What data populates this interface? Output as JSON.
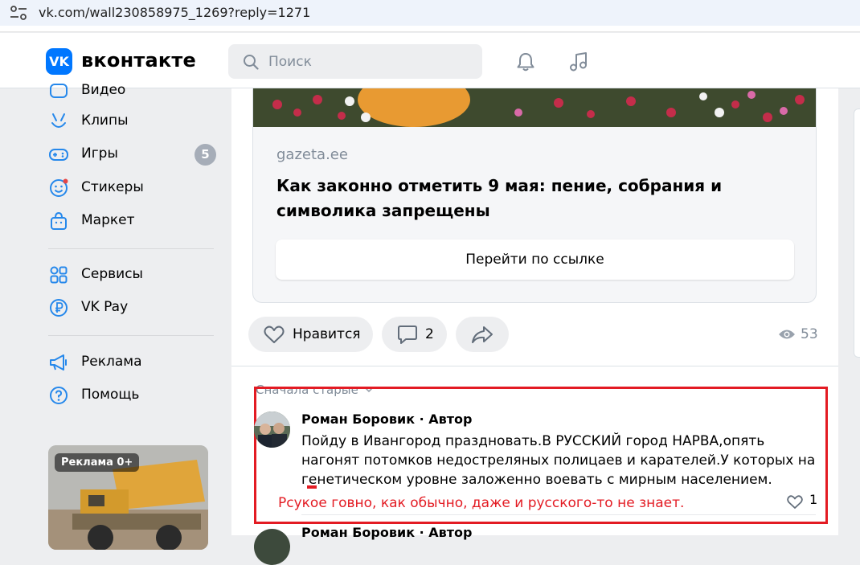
{
  "browser": {
    "url": "vk.com/wall230858975_1269?reply=1271"
  },
  "header": {
    "logo_mark": "VK",
    "logo_text": "вконтакте",
    "search_placeholder": "Поиск"
  },
  "sidebar": {
    "items": [
      {
        "label": "Видео",
        "icon": "video-icon"
      },
      {
        "label": "Клипы",
        "icon": "clips-icon"
      },
      {
        "label": "Игры",
        "icon": "gamepad-icon",
        "badge": "5"
      },
      {
        "label": "Стикеры",
        "icon": "sticker-icon"
      },
      {
        "label": "Маркет",
        "icon": "market-bag-icon"
      },
      {
        "label": "Сервисы",
        "icon": "services-grid-icon"
      },
      {
        "label": "VK Pay",
        "icon": "ruble-icon"
      },
      {
        "label": "Реклама",
        "icon": "megaphone-icon"
      },
      {
        "label": "Помощь",
        "icon": "help-icon"
      }
    ],
    "ad_label": "Реклама 0+"
  },
  "post": {
    "link": {
      "domain": "gazeta.ee",
      "title": "Как законно отметить 9 мая: пение, собрания и символика запрещены",
      "button": "Перейти по ссылке"
    },
    "actions": {
      "like_label": "Нравится",
      "comments_count": "2",
      "views_count": "53"
    }
  },
  "comments": {
    "sort_label": "Сначала старые",
    "items": [
      {
        "author": "Роман Боровик",
        "role": "· Автор",
        "text": "Пойду в Ивангород праздновать.В РУССКИЙ город НАРВА,опять нагонят потомков недостреляных полицаев и карателей.У которых на генетическом уровне заложенно воевать с мирным населением.",
        "likes": "1"
      },
      {
        "author": "Роман Боровик",
        "role": "· Автор"
      }
    ],
    "annotation": "Рсукое говно, как обычно, даже и русского-то не знает."
  },
  "colors": {
    "vk_blue": "#0077ff",
    "annotation_red": "#e31b23",
    "muted_text": "#818c99",
    "background": "#edeef0"
  }
}
